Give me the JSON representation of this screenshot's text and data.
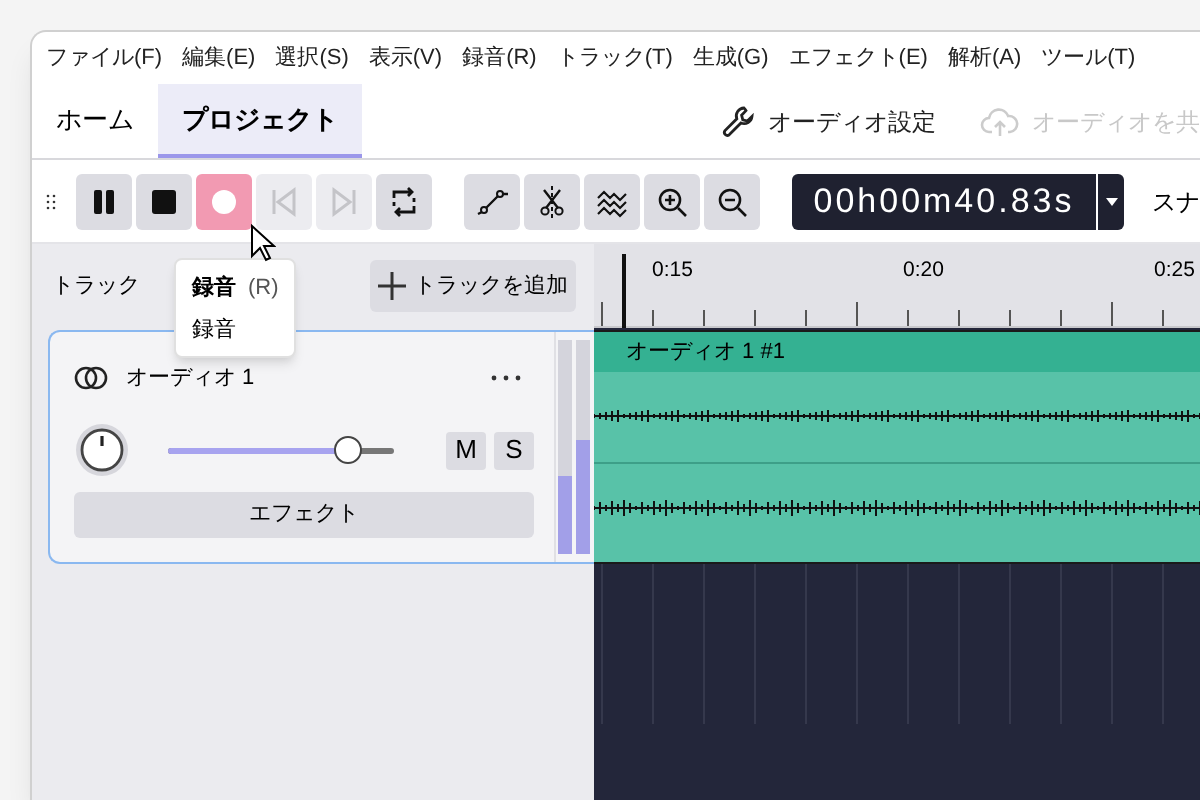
{
  "menu": [
    "ファイル(F)",
    "編集(E)",
    "選択(S)",
    "表示(V)",
    "録音(R)",
    "トラック(T)",
    "生成(G)",
    "エフェクト(E)",
    "解析(A)",
    "ツール(T)"
  ],
  "tabs": [
    {
      "label": "ホーム",
      "selected": false
    },
    {
      "label": "プロジェクト",
      "selected": true
    }
  ],
  "audio_settings": "オーディオ設定",
  "share_audio": {
    "label": "オーディオを共",
    "disabled": true
  },
  "transport": [
    {
      "kind": "pause",
      "active": false,
      "disabled": false
    },
    {
      "kind": "stop",
      "active": false,
      "disabled": false
    },
    {
      "kind": "record",
      "active": true,
      "disabled": false
    },
    {
      "kind": "prev",
      "active": false,
      "disabled": true
    },
    {
      "kind": "next",
      "active": false,
      "disabled": true
    },
    {
      "kind": "loop",
      "active": false,
      "disabled": false
    }
  ],
  "tools": [
    {
      "kind": "envelope"
    },
    {
      "kind": "trim"
    },
    {
      "kind": "waves"
    },
    {
      "kind": "zoom-in"
    },
    {
      "kind": "zoom-out"
    }
  ],
  "time": "00h00m40.83s",
  "snap": "スナ",
  "tooltip": {
    "title": "録音",
    "shortcut": "(R)",
    "description": "録音"
  },
  "tracks_header": {
    "label": "トラック",
    "add_button": "トラックを追加"
  },
  "track": {
    "name": "オーディオ 1",
    "gain": {
      "level": 0.8
    },
    "mute": "M",
    "solo": "S",
    "effects": "エフェクト",
    "meter_left": {
      "level": 0.36
    },
    "meter_right": {
      "level": 0.53
    }
  },
  "ruler": [
    "0:15",
    "0:20",
    "0:25"
  ],
  "clip": {
    "name": "オーディオ 1 #1"
  }
}
